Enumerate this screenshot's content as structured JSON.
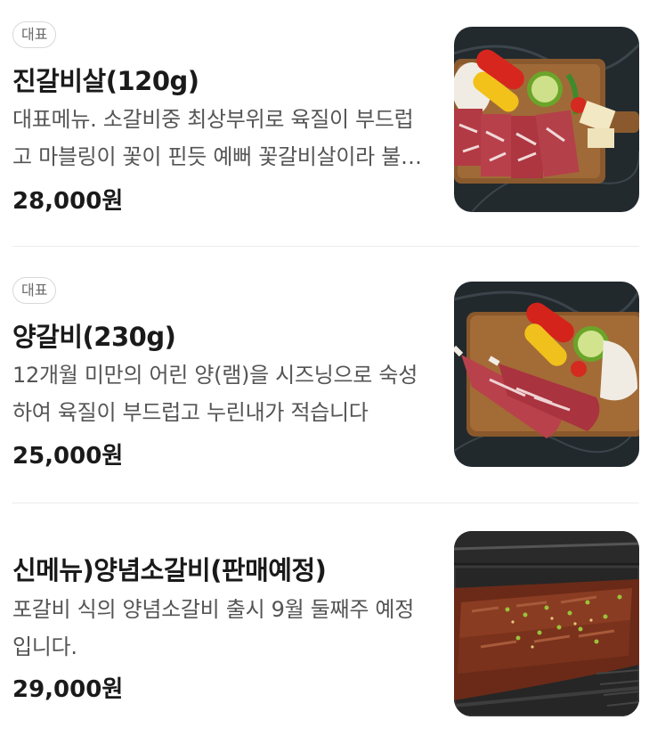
{
  "menu": {
    "items": [
      {
        "badge": "대표",
        "name": "진갈비살(120g)",
        "description": "대표메뉴. 소갈비중 최상부위로 육질이 부드럽고 마블링이 꽃이 핀듯 예뻐 꽃갈비살이라 불립니다",
        "price": "28,000원",
        "image_icon": "beef-platter-photo"
      },
      {
        "badge": "대표",
        "name": "양갈비(230g)",
        "description": "12개월 미만의 어린 양(램)을 시즈닝으로 숙성하여 육질이 부드럽고 누린내가 적습니다",
        "price": "25,000원",
        "image_icon": "lamb-rack-photo"
      },
      {
        "name": "신메뉴)양념소갈비(판매예정)",
        "description": "포갈비 식의 양념소갈비 출시 9월 둘째주 예정입니다.",
        "price": "29,000원",
        "image_icon": "grilled-ribs-photo"
      }
    ]
  },
  "colors": {
    "title": "#1a1a1a",
    "description": "#555555",
    "badge_border": "#d8d8d8",
    "divider": "#ececec"
  }
}
